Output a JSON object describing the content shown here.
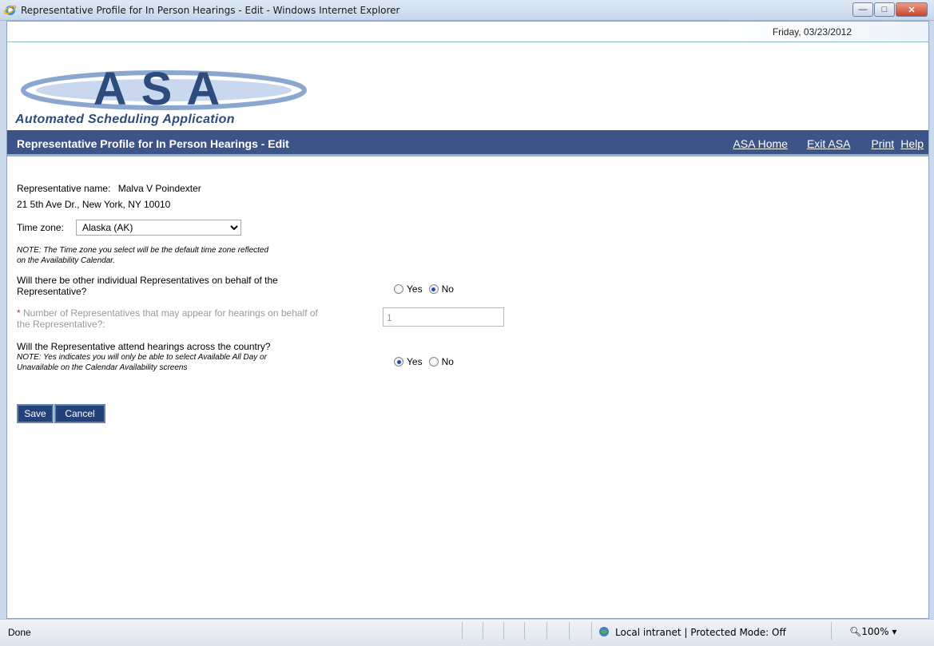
{
  "window": {
    "title": "Representative Profile for In Person Hearings - Edit - Windows Internet Explorer",
    "buttons": {
      "minimize": "—",
      "maximize": "□",
      "close": "✕"
    }
  },
  "header": {
    "date": "Friday, 03/23/2012",
    "logo_text": "ASA",
    "logo_tagline": "Automated Scheduling Application"
  },
  "nav": {
    "page_title": "Representative Profile for In Person Hearings - Edit",
    "links": {
      "home": "ASA Home",
      "exit": "Exit ASA",
      "print": "Print",
      "help": "Help"
    }
  },
  "form": {
    "rep_label": "Representative name:",
    "rep_name": "Malva V Poindexter",
    "address": "21 5th Ave Dr., New York, NY 10010",
    "timezone_label": "Time zone:",
    "timezone_value": "Alaska (AK)",
    "timezone_note_1": "NOTE: The Time zone you select will be the default time zone reflected",
    "timezone_note_2": "on the Availability Calendar.",
    "q1_line1": "Will there be other individual Representatives on behalf of the",
    "q1_line2": "Representative?",
    "q1_yes": "Yes",
    "q1_no": "No",
    "q1_selected": "No",
    "q2_req": "*",
    "q2_line1": " Number of Representatives that may appear for hearings on behalf of",
    "q2_line2": "the Representative?:",
    "q2_value": "1",
    "q3_line1": "Will the Representative attend hearings across the country?",
    "q3_note1": "NOTE: Yes indicates you will only be able to select Available All Day or",
    "q3_note2": "Unavailable on the Calendar Availability screens",
    "q3_yes": "Yes",
    "q3_no": "No",
    "q3_selected": "Yes"
  },
  "buttons": {
    "save": "Save",
    "cancel": "Cancel"
  },
  "status": {
    "left": "Done",
    "zone": "Local intranet | Protected Mode: Off",
    "zoom": "100%"
  },
  "colors": {
    "nav_bg": "#3d5488",
    "button_bg": "#23427a",
    "logo_blue": "#2d4b7c"
  }
}
